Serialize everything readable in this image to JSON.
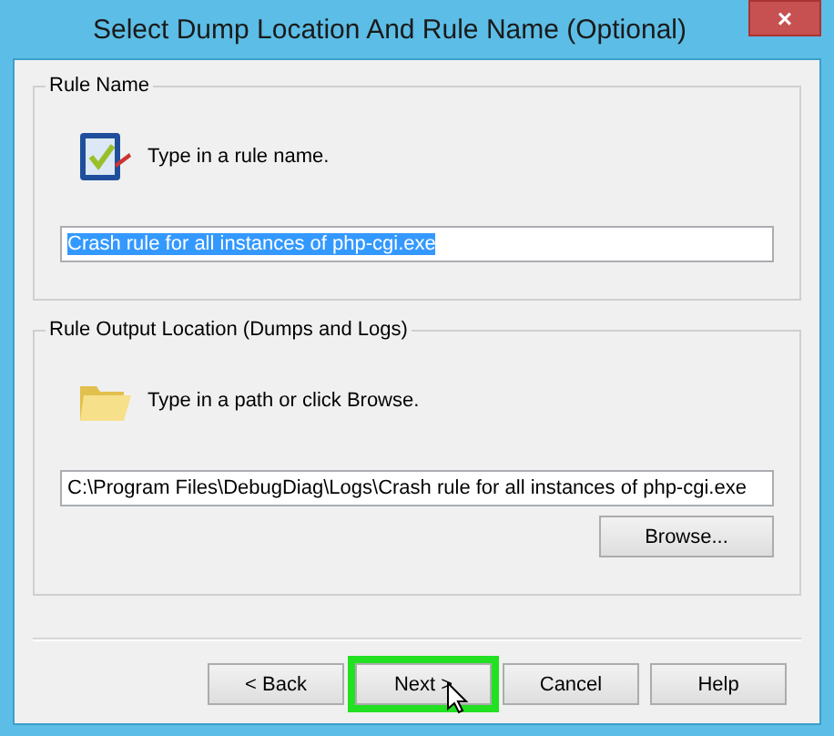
{
  "window": {
    "title": "Select Dump Location And Rule Name (Optional)",
    "close": "×"
  },
  "groups": [
    {
      "kind": "rule",
      "legend": "Rule Name",
      "prompt": "Type in a rule name.",
      "field": {
        "value": "Crash rule for all instances of php-cgi.exe",
        "selected": true
      }
    },
    {
      "kind": "folder",
      "legend": "Rule Output Location (Dumps and Logs)",
      "prompt": "Type in a path or click Browse.",
      "field": {
        "value": "C:\\Program Files\\DebugDiag\\Logs\\Crash rule for all instances of php-cgi.exe",
        "selected": false
      },
      "button": "Browse..."
    }
  ],
  "buttons": [
    {
      "label": "< Back",
      "highlighted": false
    },
    {
      "label": "Next >",
      "highlighted": true
    },
    {
      "label": "Cancel",
      "highlighted": false
    },
    {
      "label": "Help",
      "highlighted": false
    }
  ]
}
